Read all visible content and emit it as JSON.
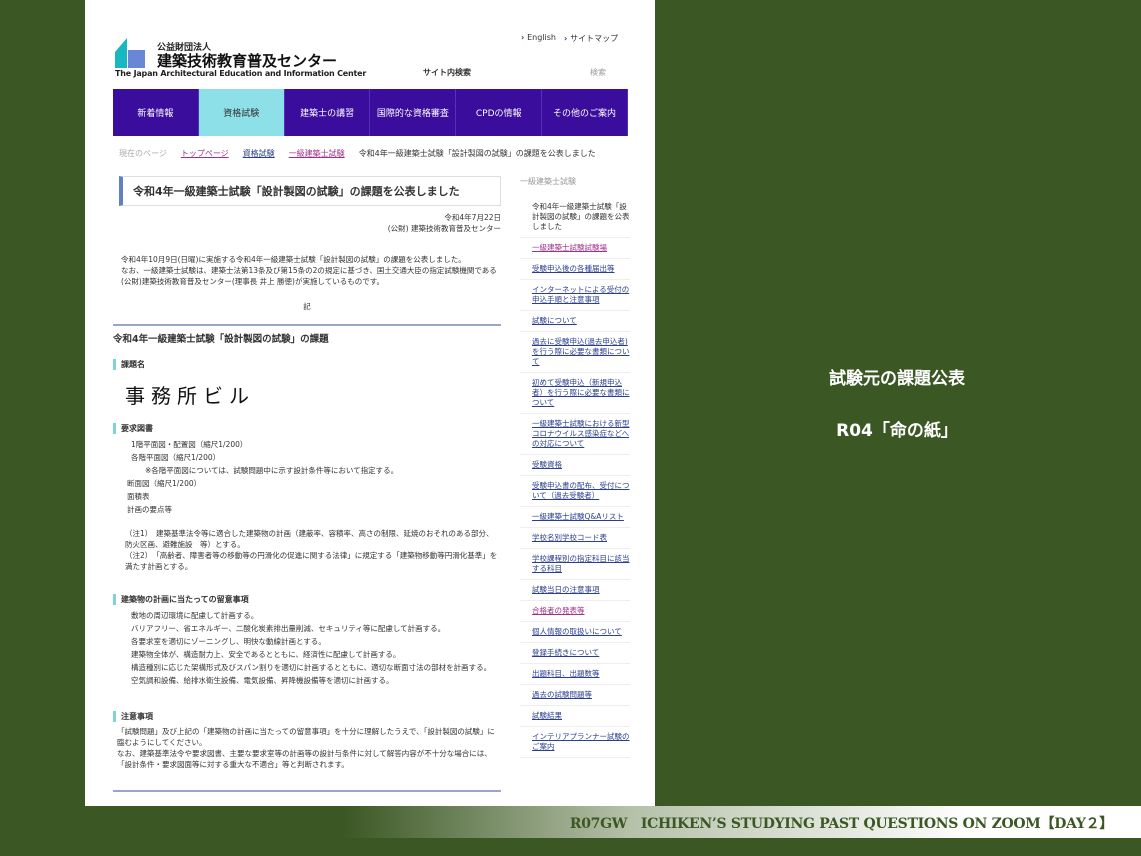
{
  "header": {
    "org_small": "公益財団法人",
    "org_name": "建築技術教育普及センター",
    "org_en": "The Japan Architectural Education and Information Center",
    "links": [
      "English",
      "サイトマップ"
    ],
    "search_label": "サイト内検索",
    "search_button": "検索"
  },
  "nav": {
    "items": [
      "新着情報",
      "資格試験",
      "建築士の講習",
      "国際的な資格審査",
      "CPDの情報",
      "その他のご案内"
    ],
    "active": 1
  },
  "breadcrumb": {
    "here": "現在のページ",
    "items": [
      "トップページ",
      "資格試験",
      "一級建築士試験"
    ],
    "current": "令和4年一級建築士試験「設計製図の試験」の課題を公表しました"
  },
  "article": {
    "title": "令和4年一級建築士試験「設計製図の試験」の課題を公表しました",
    "date": "令和4年7月22日",
    "issuer": "(公財) 建築技術教育普及センター",
    "para1": "令和4年10月9日(日曜)に実施する令和4年一級建築士試験「設計製図の試験」の課題を公表しました。",
    "para2": "なお、一級建築士試験は、建築士法第13条及び第15条の2の規定に基づき、国土交通大臣の指定試験機関である(公財)建築技術教育普及センター(理事長 井上 勝徳)が実施しているものです。",
    "ki": "記",
    "section_title": "令和4年一級建築士試験「設計製図の試験」の課題",
    "h_name": "課題名",
    "task_name": "事務所ビル",
    "h_drawings": "要求図書",
    "drawings": [
      "1階平面図・配置図（縮尺1/200）",
      "各階平面図（縮尺1/200）",
      "※各階平面図については、試験問題中に示す設計条件等において指定する。",
      "断面図（縮尺1/200）",
      "面積表",
      "計画の要点等"
    ],
    "note1": "（注1）　建築基準法令等に適合した建築物の計画（建蔽率、容積率、高さの制限、延焼のおそれのある部分、防火区画、避難施設　等）とする。",
    "note2": "（注2）　「高齢者、障害者等の移動等の円滑化の促進に関する法律」に規定する「建築物移動等円滑化基準」を満たす計画とする。",
    "h_points": "建築物の計画に当たっての留意事項",
    "points": [
      "敷地の周辺環境に配慮して計画する。",
      "バリアフリー、省エネルギー、二酸化炭素排出量削減、セキュリティ等に配慮して計画する。",
      "各要求室を適切にゾーニングし、明快な動線計画とする。",
      "建築物全体が、構造耐力上、安全であるとともに、経済性に配慮して計画する。",
      "構造種別に応じた架構形式及びスパン割りを適切に計画するとともに、適切な断面寸法の部材を計画する。",
      "空気調和設備、給排水衛生設備、電気設備、昇降機設備等を適切に計画する。"
    ],
    "h_caution": "注意事項",
    "caution1": "「試験問題」及び上記の「建築物の計画に当たっての留意事項」を十分に理解したうえで、「設計製図の試験」に臨むようにしてください。",
    "caution2": "なお、建築基準法令や要求図書、主要な要求室等の計画等の設計与条件に対して解答内容が不十分な場合には、「設計条件・要求図面等に対する重大な不適合」等と判断されます。"
  },
  "sidebar": {
    "heading": "一級建築士試験",
    "current": "令和4年一級建築士試験「設計製図の試験」の課題を公表しました",
    "items": [
      "一級建築士試験試験場",
      "受験申込後の各種届出等",
      "インターネットによる受付の申込手順と注意事項",
      "試験について",
      "過去に受験申込(過去申込者)を行う際に必要な書類について",
      "初めて受験申込（新規申込者）を行う際に必要な書類について",
      "一級建築士試験における新型コロナウイルス感染症などへの対応について",
      "受験資格",
      "受験申込書の配布、受付について（過去受験者）",
      "一級建築士試験Q&Aリスト",
      "学校名別学校コード表",
      "学校課程別の指定科目に該当する科目",
      "試験当日の注意事項",
      "合格者の発表等",
      "個人情報の取扱いについて",
      "登録手続きについて",
      "出題科目、出題数等",
      "過去の試験問題等",
      "試験結果",
      "インテリアプランナー試験のご案内"
    ],
    "visited": [
      0,
      13
    ]
  },
  "slide": {
    "caption1": "試験元の課題公表",
    "caption2": "R04「命の紙」",
    "footer": "R07GW　ICHIKEN’S STUDYING PAST QUESTIONS ON ZOOM【DAY２】"
  },
  "colors": {
    "background": "#3b5723",
    "nav": "#3a0d9c",
    "nav_active": "#8ddfe8",
    "accent": "#7fd4d8"
  }
}
